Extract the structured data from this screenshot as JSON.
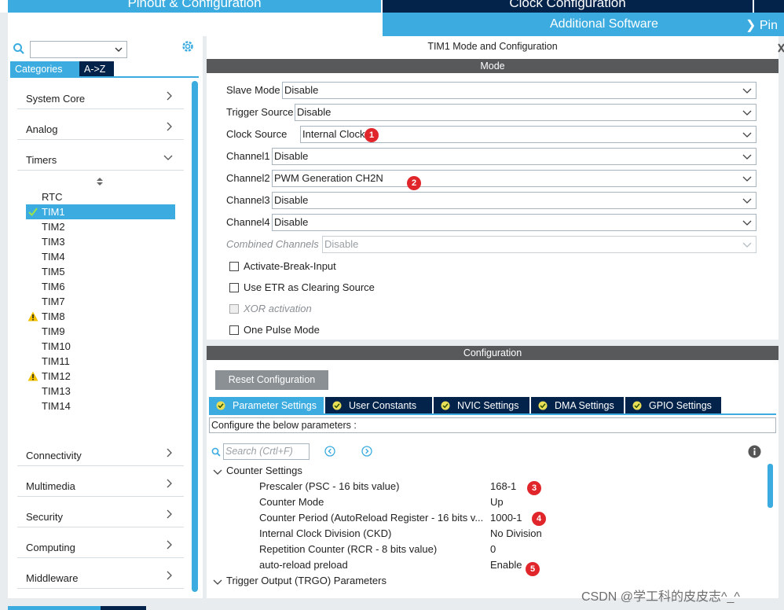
{
  "top_tabs": {
    "pinout": "Pinout & Configuration",
    "clock": "Clock Configuration",
    "additional_software": "Additional Software",
    "pinout_short": "Pin"
  },
  "sidebar": {
    "tab_categories": "Categories",
    "tab_az": "A->Z",
    "categories": [
      {
        "label": "System Core"
      },
      {
        "label": "Analog"
      },
      {
        "label": "Timers"
      },
      {
        "label": "Connectivity"
      },
      {
        "label": "Multimedia"
      },
      {
        "label": "Security"
      },
      {
        "label": "Computing"
      },
      {
        "label": "Middleware"
      }
    ],
    "timers": [
      {
        "label": "RTC",
        "status": ""
      },
      {
        "label": "TIM1",
        "status": "ok"
      },
      {
        "label": "TIM2",
        "status": ""
      },
      {
        "label": "TIM3",
        "status": ""
      },
      {
        "label": "TIM4",
        "status": ""
      },
      {
        "label": "TIM5",
        "status": ""
      },
      {
        "label": "TIM6",
        "status": ""
      },
      {
        "label": "TIM7",
        "status": ""
      },
      {
        "label": "TIM8",
        "status": "warning"
      },
      {
        "label": "TIM9",
        "status": ""
      },
      {
        "label": "TIM10",
        "status": ""
      },
      {
        "label": "TIM11",
        "status": ""
      },
      {
        "label": "TIM12",
        "status": "warning"
      },
      {
        "label": "TIM13",
        "status": ""
      },
      {
        "label": "TIM14",
        "status": ""
      }
    ]
  },
  "mode_panel": {
    "title": "TIM1 Mode and Configuration",
    "section": "Mode",
    "rows": [
      {
        "label": "Slave Mode",
        "value": "Disable"
      },
      {
        "label": "Trigger Source",
        "value": "Disable"
      },
      {
        "label": "Clock Source",
        "value": "Internal Clock",
        "badge": "1"
      },
      {
        "label": "Channel1",
        "value": "Disable"
      },
      {
        "label": "Channel2",
        "value": "PWM Generation CH2N",
        "badge": "2"
      },
      {
        "label": "Channel3",
        "value": "Disable"
      },
      {
        "label": "Channel4",
        "value": "Disable"
      },
      {
        "label": "Combined Channels",
        "value": "Disable",
        "disabled": true
      }
    ],
    "checks": [
      {
        "label": "Activate-Break-Input"
      },
      {
        "label": "Use ETR as Clearing Source"
      },
      {
        "label": "XOR activation",
        "disabled": true
      },
      {
        "label": "One Pulse Mode"
      }
    ]
  },
  "config_panel": {
    "section": "Configuration",
    "reset_label": "Reset Configuration",
    "tabs": [
      "Parameter Settings",
      "User Constants",
      "NVIC Settings",
      "DMA Settings",
      "GPIO Settings"
    ],
    "description": "Configure the below parameters :",
    "search_placeholder": "Search (Crtl+F)",
    "groups": [
      "Counter Settings",
      "Trigger Output (TRGO) Parameters"
    ],
    "params": [
      {
        "name": "Prescaler (PSC - 16 bits value)",
        "value": "168-1",
        "badge": "3"
      },
      {
        "name": "Counter Mode",
        "value": "Up"
      },
      {
        "name": "Counter Period (AutoReload Register - 16 bits v...",
        "value": "1000-1",
        "badge": "4"
      },
      {
        "name": "Internal Clock Division (CKD)",
        "value": "No Division"
      },
      {
        "name": "Repetition Counter (RCR - 8 bits value)",
        "value": "0"
      },
      {
        "name": "auto-reload preload",
        "value": "Enable",
        "badge": "5"
      }
    ]
  },
  "watermark": "CSDN @学工科的皮皮志^_^",
  "colors": {
    "accent": "#3cace0",
    "navy": "#03234b",
    "section": "#57595a",
    "badge": "#e0262a"
  }
}
